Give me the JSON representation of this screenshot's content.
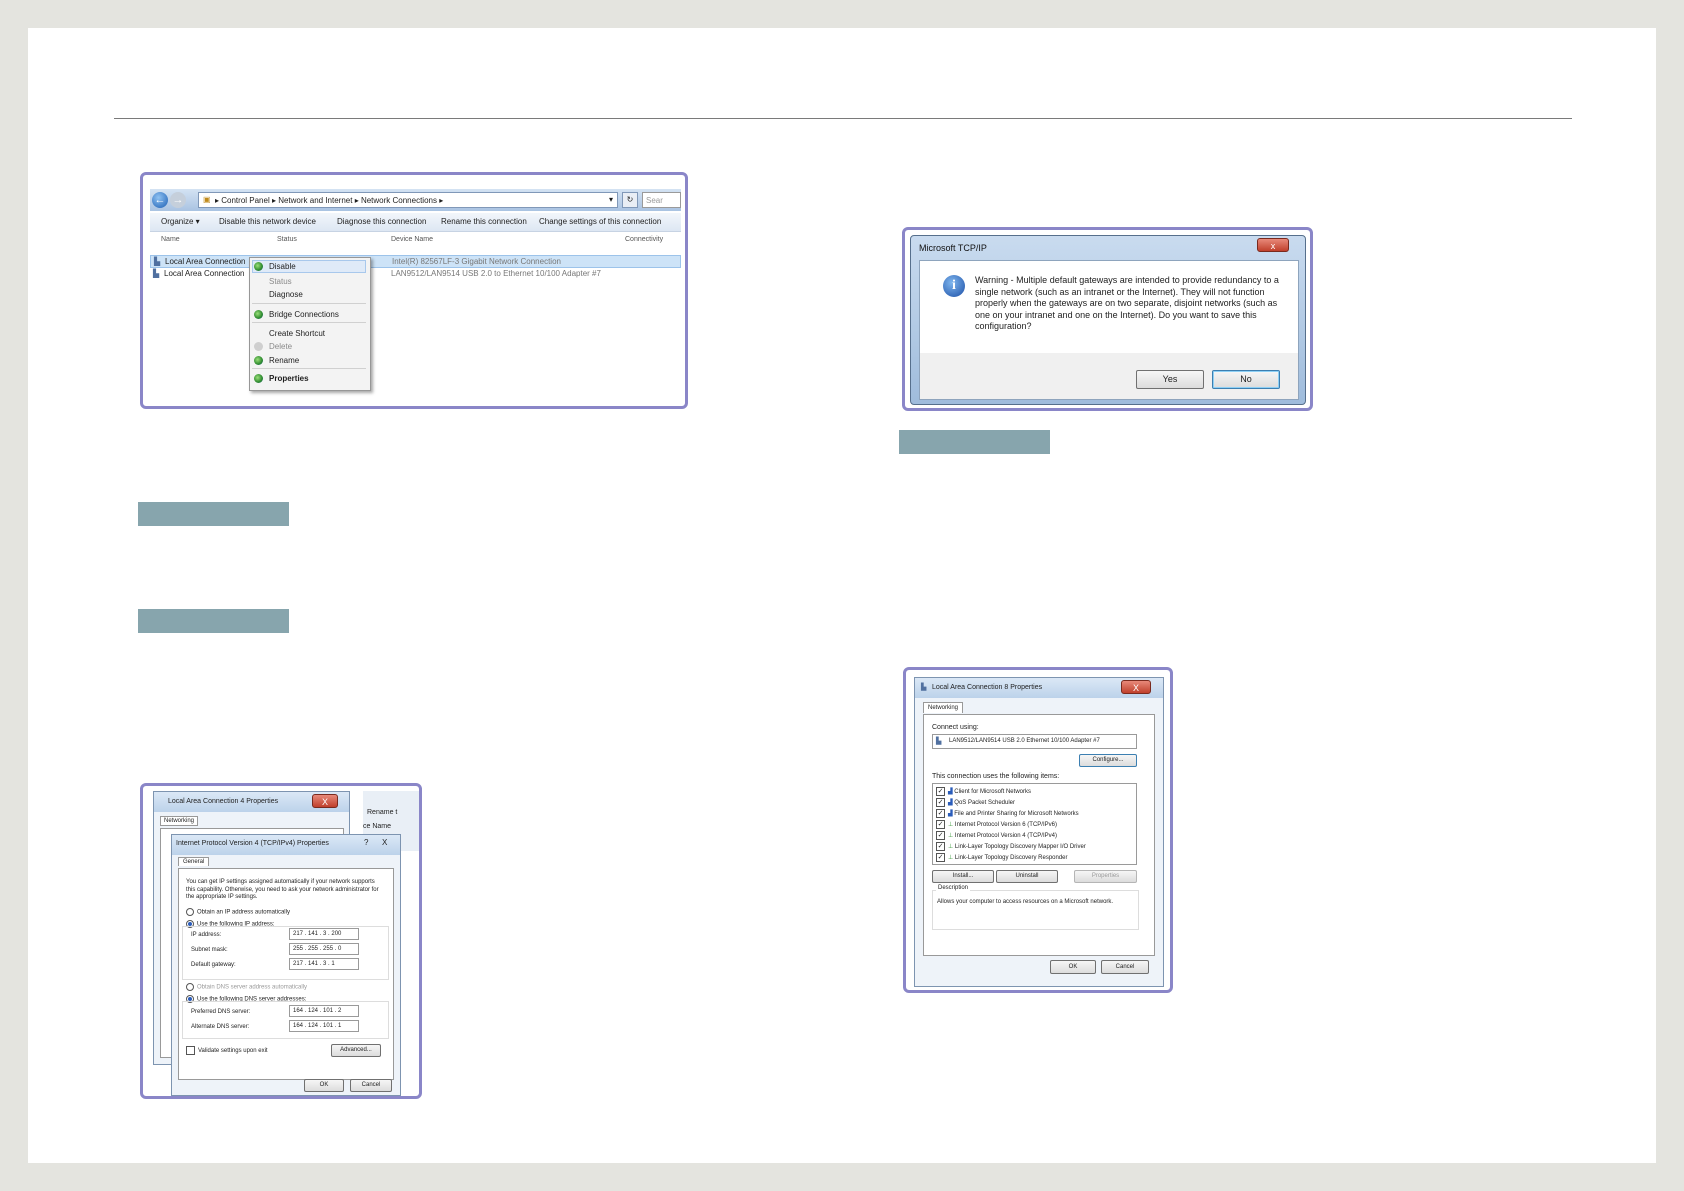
{
  "shot1": {
    "breadcrumb": [
      "Control Panel",
      "Network and Internet",
      "Network Connections"
    ],
    "search_placeholder": "Sear",
    "toolbar": [
      "Organize ▾",
      "Disable this network device",
      "Diagnose this connection",
      "Rename this connection",
      "Change settings of this connection"
    ],
    "columns": [
      "Name",
      "Status",
      "Device Name",
      "Connectivity"
    ],
    "rows": [
      {
        "name": "Local Area Connection",
        "device": "Intel(R) 82567LF-3 Gigabit Network Connection"
      },
      {
        "name": "Local Area Connection",
        "device": "LAN9512/LAN9514 USB 2.0 to Ethernet 10/100 Adapter #7"
      }
    ],
    "menu": [
      "Disable",
      "Status",
      "Diagnose",
      "Bridge Connections",
      "Create Shortcut",
      "Delete",
      "Rename",
      "Properties"
    ]
  },
  "shot2": {
    "title": "Microsoft TCP/IP",
    "close": "x",
    "message": "Warning - Multiple default gateways are intended to provide redundancy to a single network (such as an intranet or the Internet). They will not function properly when the gateways are on two separate, disjoint networks (such as one on your intranet and one on the Internet). Do you want to save this configuration?",
    "yes": "Yes",
    "no": "No"
  },
  "shot3": {
    "back_title": "Local Area Connection 4 Properties",
    "back_tab": "Networking",
    "back_side": [
      "Rename t",
      "ce Name"
    ],
    "title": "Internet Protocol Version 4 (TCP/IPv4) Properties",
    "title_buttons": [
      "?",
      "X"
    ],
    "tab": "General",
    "intro": "You can get IP settings assigned automatically if your network supports this capability. Otherwise, you need to ask your network administrator for the appropriate IP settings.",
    "auto_ip": "Obtain an IP address automatically",
    "manual_ip": "Use the following IP address:",
    "ip_label": "IP address:",
    "ip": "217 . 141 . 3 . 200",
    "mask_label": "Subnet mask:",
    "mask": "255 . 255 . 255 . 0",
    "gw_label": "Default gateway:",
    "gw": "217 . 141 . 3 . 1",
    "auto_dns": "Obtain DNS server address automatically",
    "manual_dns": "Use the following DNS server addresses:",
    "pdns_label": "Preferred DNS server:",
    "pdns": "164 . 124 . 101 . 2",
    "adns_label": "Alternate DNS server:",
    "adns": "164 . 124 . 101 . 1",
    "validate": "Validate settings upon exit",
    "advanced": "Advanced...",
    "ok": "OK",
    "cancel": "Cancel"
  },
  "shot4": {
    "title": "Local Area Connection 8 Properties",
    "close": "X",
    "tab": "Networking",
    "connect_using": "Connect using:",
    "adapter": "LAN9512/LAN9514 USB 2.0 Ethernet 10/100 Adapter #7",
    "configure": "Configure...",
    "items_label": "This connection uses the following items:",
    "items": [
      "Client for Microsoft Networks",
      "QoS Packet Scheduler",
      "File and Printer Sharing for Microsoft Networks",
      "Internet Protocol Version 6 (TCP/IPv6)",
      "Internet Protocol Version 4 (TCP/IPv4)",
      "Link-Layer Topology Discovery Mapper I/O Driver",
      "Link-Layer Topology Discovery Responder"
    ],
    "install": "Install...",
    "uninstall": "Uninstall",
    "properties": "Properties",
    "description_label": "Description",
    "description": "Allows your computer to access resources on a Microsoft network.",
    "ok": "OK",
    "cancel": "Cancel"
  }
}
